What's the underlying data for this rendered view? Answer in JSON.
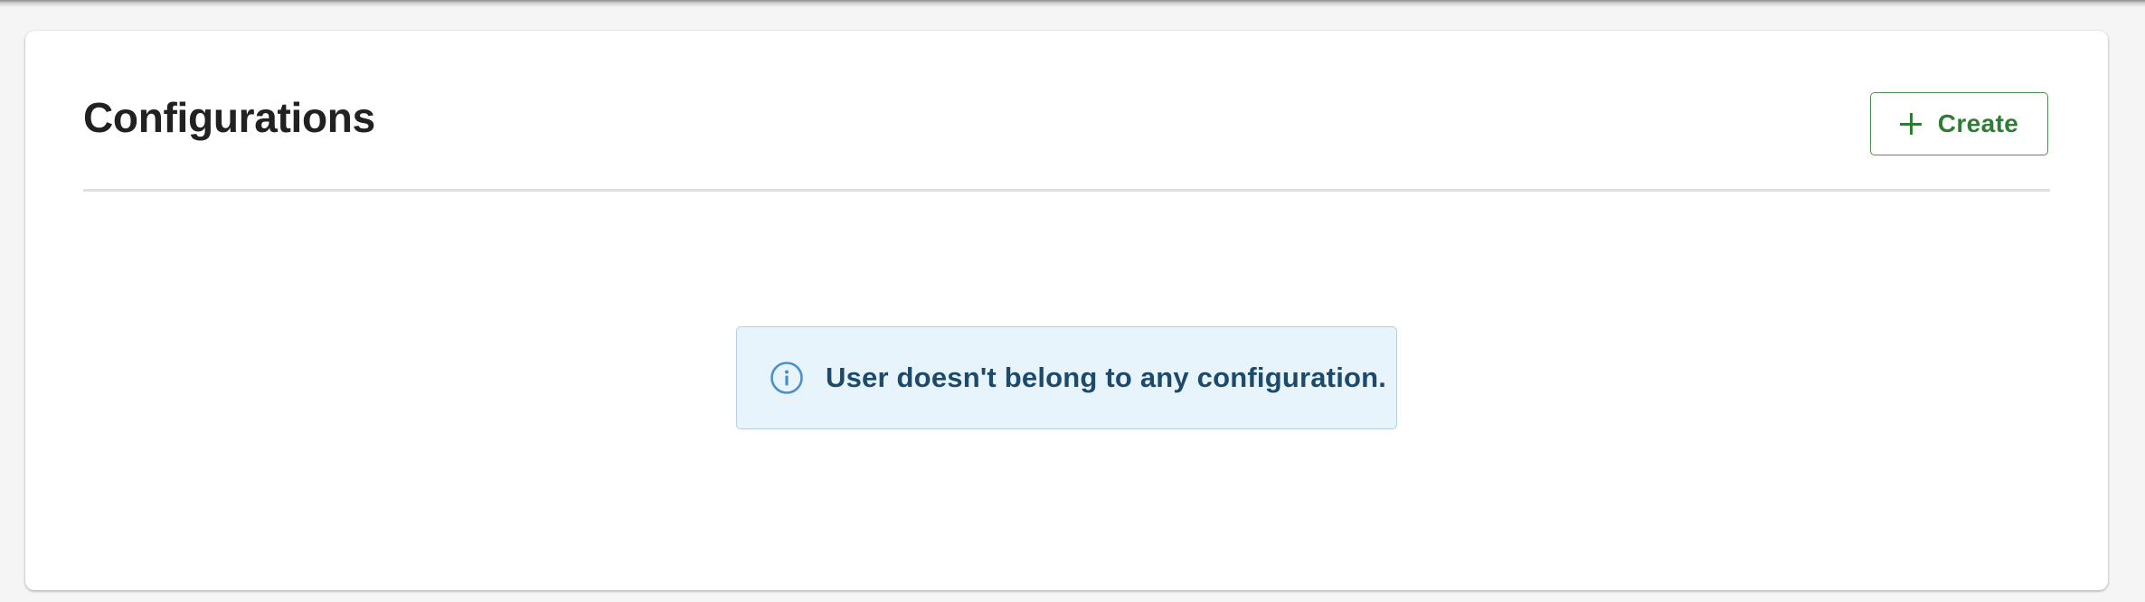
{
  "header": {
    "title": "Configurations",
    "create_label": "Create"
  },
  "alert": {
    "message": "User doesn't belong to any configuration.",
    "type": "info"
  },
  "icons": {
    "create": "plus-icon",
    "alert": "info-icon"
  },
  "colors": {
    "accent": "#2e7d32",
    "alert_bg": "#e8f4fc",
    "alert_text": "#1d4a6b",
    "alert_icon": "#4a90c8"
  }
}
